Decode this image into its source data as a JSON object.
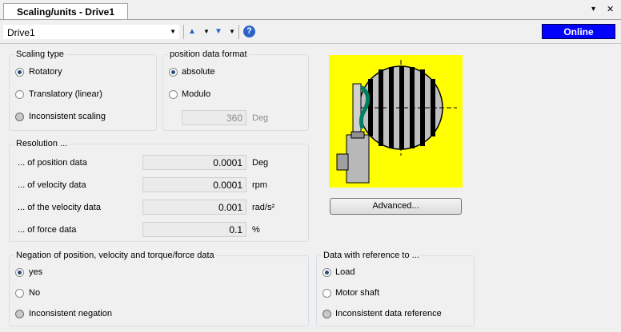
{
  "tab": {
    "title": "Scaling/units - Drive1"
  },
  "window": {
    "pin_glyph": "▾",
    "close_glyph": "✕"
  },
  "toolbar": {
    "drive_select": "Drive1",
    "status": "Online",
    "status_color": "#0000ff",
    "icons": [
      "combo-arrow-icon",
      "arrow-up-icon",
      "arrow-down-icon",
      "help-icon"
    ]
  },
  "scaling_type": {
    "title": "Scaling type",
    "options": [
      "Rotatory",
      "Translatory (linear)",
      "Inconsistent scaling"
    ],
    "selected": "Rotatory"
  },
  "position_format": {
    "title": "position data format",
    "options": [
      "absolute",
      "Modulo"
    ],
    "selected": "absolute",
    "modulo_value": "360",
    "modulo_unit": "Deg"
  },
  "resolution": {
    "title": "Resolution ...",
    "rows": [
      {
        "label": "... of position data",
        "value": "0.0001",
        "unit": "Deg"
      },
      {
        "label": "... of velocity data",
        "value": "0.0001",
        "unit": "rpm"
      },
      {
        "label": "... of the velocity data",
        "value": "0.001",
        "unit": "rad/s²"
      },
      {
        "label": "... of force data",
        "value": "0.1",
        "unit": "%"
      }
    ]
  },
  "advanced_button": "Advanced...",
  "negation": {
    "title": "Negation of position, velocity and torque/force data",
    "options": [
      "yes",
      "No",
      "Inconsistent negation"
    ],
    "selected": "yes"
  },
  "reference": {
    "title": "Data with reference to ...",
    "options": [
      "Load",
      "Motor shaft",
      "Inconsistent data reference"
    ],
    "selected": "Load"
  }
}
